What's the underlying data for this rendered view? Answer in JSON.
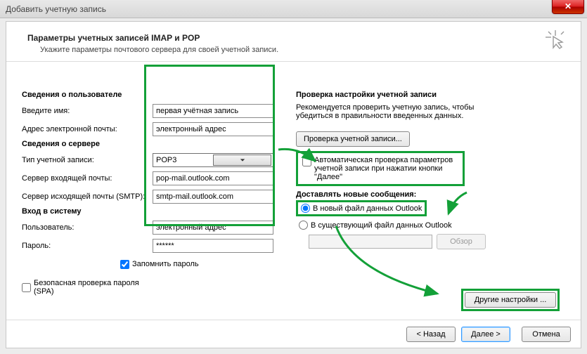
{
  "window_title": "Добавить учетную запись",
  "header": {
    "title": "Параметры учетных записей IMAP и POP",
    "subtitle": "Укажите параметры почтового сервера для своей учетной записи."
  },
  "user": {
    "section": "Сведения о пользователе",
    "name_label": "Введите имя:",
    "name_value": "первая учётная запись",
    "email_label": "Адрес электронной почты:",
    "email_value": "электронный адрес"
  },
  "server": {
    "section": "Сведения о сервере",
    "type_label": "Тип учетной записи:",
    "type_value": "POP3",
    "incoming_label": "Сервер входящей почты:",
    "incoming_value": "pop-mail.outlook.com",
    "outgoing_label": "Сервер исходящей почты (SMTP):",
    "outgoing_value": "smtp-mail.outlook.com"
  },
  "login": {
    "section": "Вход в систему",
    "user_label": "Пользователь:",
    "user_value": "электронный адрес",
    "pass_label": "Пароль:",
    "pass_value": "******",
    "remember_label": "Запомнить пароль",
    "spa_label": "Безопасная проверка пароля (SPA)"
  },
  "test": {
    "section": "Проверка настройки учетной записи",
    "desc": "Рекомендуется проверить учетную запись, чтобы убедиться в правильности введенных данных.",
    "button": "Проверка учетной записи...",
    "autocheck": "Автоматическая проверка параметров учетной записи при нажатии кнопки \"Далее\""
  },
  "deliver": {
    "section": "Доставлять новые сообщения:",
    "new_file": "В новый файл данных Outlook",
    "existing_file": "В существующий файл данных Outlook",
    "browse": "Обзор"
  },
  "more_settings": "Другие настройки ...",
  "footer": {
    "back": "< Назад",
    "next": "Далее >",
    "cancel": "Отмена"
  }
}
